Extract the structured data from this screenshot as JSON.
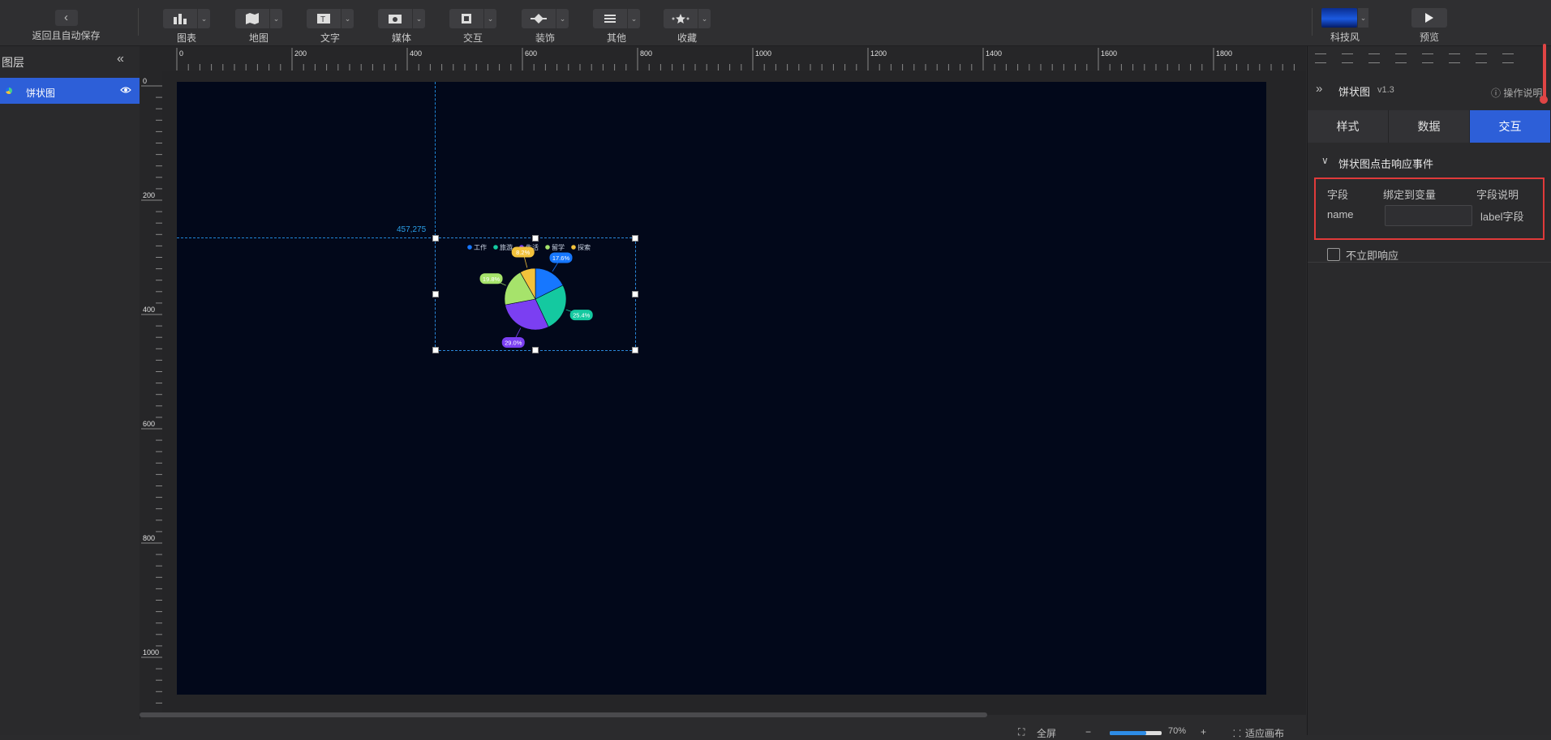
{
  "toolbar": {
    "back_label": "返回且自动保存",
    "tools": [
      {
        "label": "图表"
      },
      {
        "label": "地图"
      },
      {
        "label": "文字"
      },
      {
        "label": "媒体"
      },
      {
        "label": "交互"
      },
      {
        "label": "装饰"
      },
      {
        "label": "其他"
      },
      {
        "label": "收藏"
      }
    ],
    "theme_label": "科技风",
    "preview_label": "预览"
  },
  "layers": {
    "title": "图层",
    "items": [
      {
        "name": "饼状图"
      }
    ]
  },
  "ruler": {
    "top_ticks": [
      "0",
      "200",
      "400",
      "600",
      "800",
      "1000",
      "1200",
      "1400",
      "1600",
      "1800"
    ],
    "left_ticks": [
      "0",
      "200",
      "400",
      "600",
      "800",
      "1000"
    ]
  },
  "canvas": {
    "coord_readout": "457,275"
  },
  "chart_data": {
    "type": "pie",
    "legend": [
      "工作",
      "旅游",
      "生活",
      "留学",
      "探索"
    ],
    "series": [
      {
        "labels": [
          "工作",
          "旅游",
          "生活",
          "留学",
          "探索"
        ],
        "values": [
          17.6,
          25.4,
          29.0,
          19.8,
          8.2
        ],
        "data_labels": [
          "17.6%",
          "25.4%",
          "29.0%",
          "19.8%",
          "8.2%"
        ],
        "colors": [
          "#1677ff",
          "#14c9a0",
          "#7b3ff2",
          "#a6e36b",
          "#f3c23c"
        ]
      }
    ],
    "legend_position": "top"
  },
  "bottom": {
    "fullscreen_label": "全屏",
    "zoom_minus": "−",
    "zoom_value": "70%",
    "zoom_fraction": 0.7,
    "zoom_plus": "+",
    "fit_label": "适应画布"
  },
  "right_panel": {
    "component_title": "饼状图",
    "component_version": "v1.3",
    "help_label": "操作说明",
    "tabs": [
      {
        "label": "样式"
      },
      {
        "label": "数据"
      },
      {
        "label": "交互"
      }
    ],
    "active_tab": "交互",
    "section_title": "饼状图点击响应事件",
    "table": {
      "headers": [
        "字段",
        "绑定到变量",
        "字段说明"
      ],
      "rows": [
        {
          "field": "name",
          "variable": "",
          "desc": "label字段"
        }
      ]
    },
    "checkbox_label": "不立即响应",
    "checkbox_checked": false
  }
}
